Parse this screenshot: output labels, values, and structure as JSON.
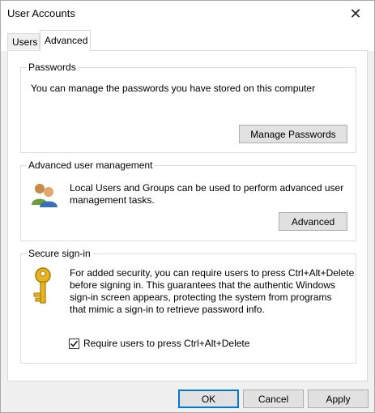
{
  "window": {
    "title": "User Accounts",
    "close_glyph": "✕"
  },
  "tabs": [
    {
      "label": "Users",
      "active": false
    },
    {
      "label": "Advanced",
      "active": true
    }
  ],
  "passwords": {
    "label": "Passwords",
    "description": "You can manage the passwords you have stored on this computer",
    "button_label": "Manage Passwords"
  },
  "advanced_management": {
    "label": "Advanced user management",
    "description_line1": "Local Users and Groups can be used to perform advanced user",
    "description_line2": "management tasks.",
    "button_label": "Advanced",
    "icon": "users-group-icon"
  },
  "secure_signin": {
    "label": "Secure sign-in",
    "lines": [
      "For added security, you can require users to press Ctrl+Alt+Delete",
      "before signing in. This guarantees that the authentic Windows",
      "sign-in screen appears, protecting the system from programs",
      "that mimic a sign-in to retrieve password info."
    ],
    "icon": "key-icon",
    "checkbox_label": "Require users to press Ctrl+Alt+Delete",
    "checkbox_checked": true
  },
  "footer": {
    "ok_label": "OK",
    "cancel_label": "Cancel",
    "apply_label": "Apply"
  },
  "colors": {
    "accent": "#0078d7",
    "key_gold": "#d4a017"
  }
}
